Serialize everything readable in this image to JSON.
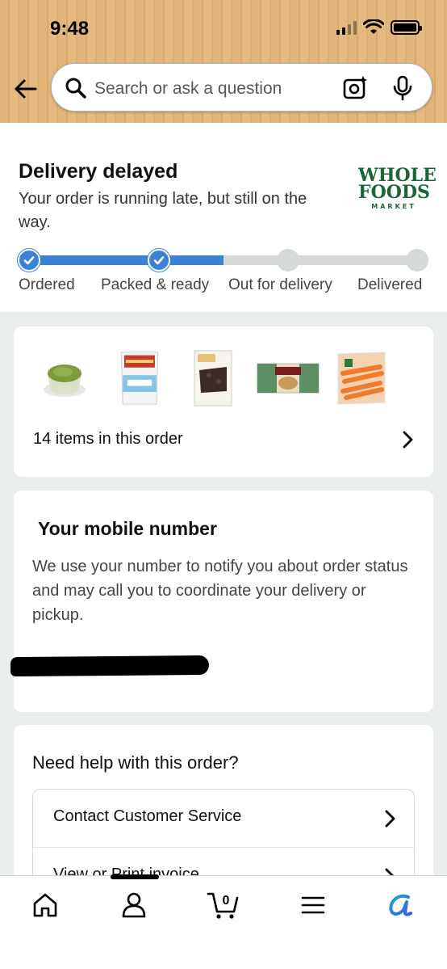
{
  "status_bar": {
    "time": "9:48"
  },
  "search": {
    "placeholder": "Search or ask a question"
  },
  "delivery": {
    "title": "Delivery delayed",
    "description": "Your order is running late, but still on the way.",
    "store_logo_line1": "WHOLE",
    "store_logo_line2": "FOODS",
    "store_logo_line3": "MARKET",
    "progress_fraction": 0.5,
    "steps": [
      {
        "label": "Ordered",
        "done": true
      },
      {
        "label": "Packed & ready",
        "done": true
      },
      {
        "label": "Out for delivery",
        "done": false
      },
      {
        "label": "Delivered",
        "done": false
      }
    ]
  },
  "order_items": {
    "count_text": "14 items in this order",
    "thumbnails": [
      "guacamole-cup",
      "boulder-chips-bag",
      "simple-mills-brownie-box",
      "cranberry-crackers-box",
      "petite-carrots-bag"
    ]
  },
  "mobile": {
    "title": "Your mobile number",
    "description": "We use your number to notify you about order status and may call you to coordinate your delivery or pickup."
  },
  "help": {
    "title": "Need help with this order?",
    "options": [
      "Contact Customer Service",
      "View or Print invoice"
    ]
  },
  "colors": {
    "accent_blue": "#3b82d6",
    "header_tan": "#e2b57a",
    "whole_foods_green": "#1b6634"
  },
  "bottom_nav": [
    "home-icon",
    "account-icon",
    "cart-icon",
    "menu-icon",
    "rufus-icon"
  ],
  "cart_count": "0"
}
